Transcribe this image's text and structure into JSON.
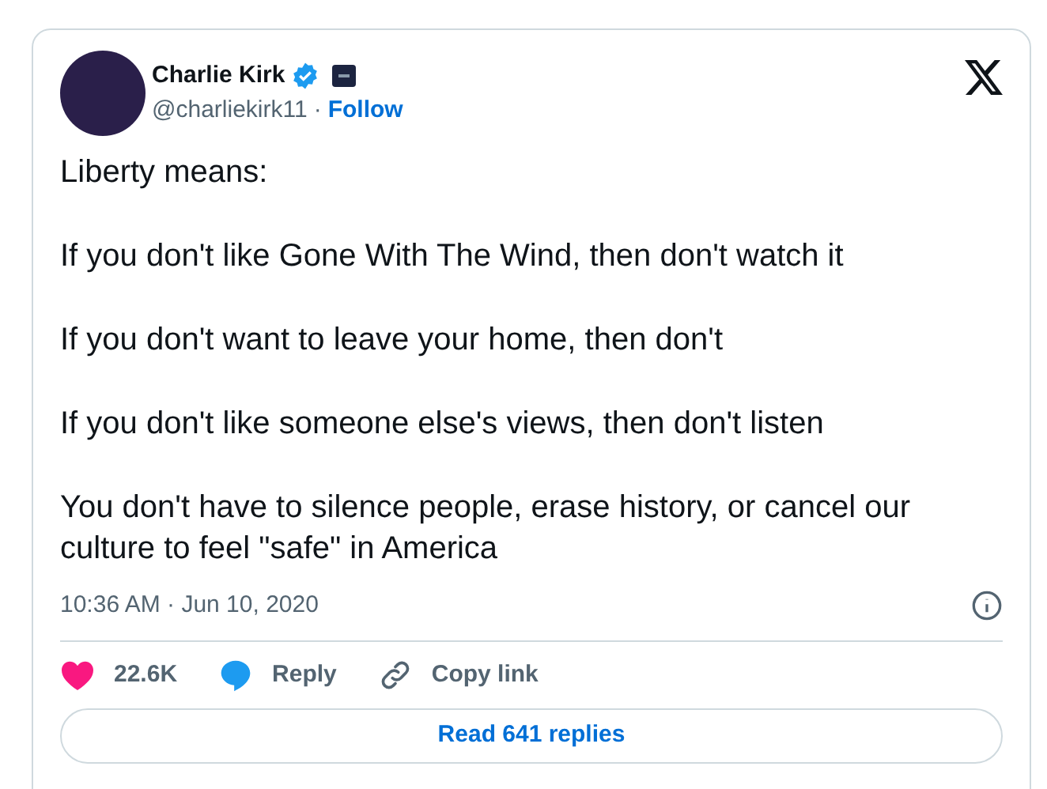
{
  "author": {
    "name": "Charlie Kirk",
    "verified": true,
    "handle": "@charliekirk11",
    "separator": "·",
    "follow": "Follow"
  },
  "paragraphs": [
    "Liberty means:",
    "If you don't like Gone With The Wind, then don't watch it",
    "If you don't want to leave your home, then don't",
    "If you don't like someone else's views, then don't listen",
    "You don't have to silence people, erase history, or cancel our culture to feel \"safe\" in America"
  ],
  "timestamp": "10:36 AM · Jun 10, 2020",
  "actions": [
    {
      "kind": "like",
      "label": "22.6K"
    },
    {
      "kind": "reply",
      "label": "Reply"
    },
    {
      "kind": "copy",
      "label": "Copy link"
    }
  ],
  "read_replies": "Read 641 replies"
}
